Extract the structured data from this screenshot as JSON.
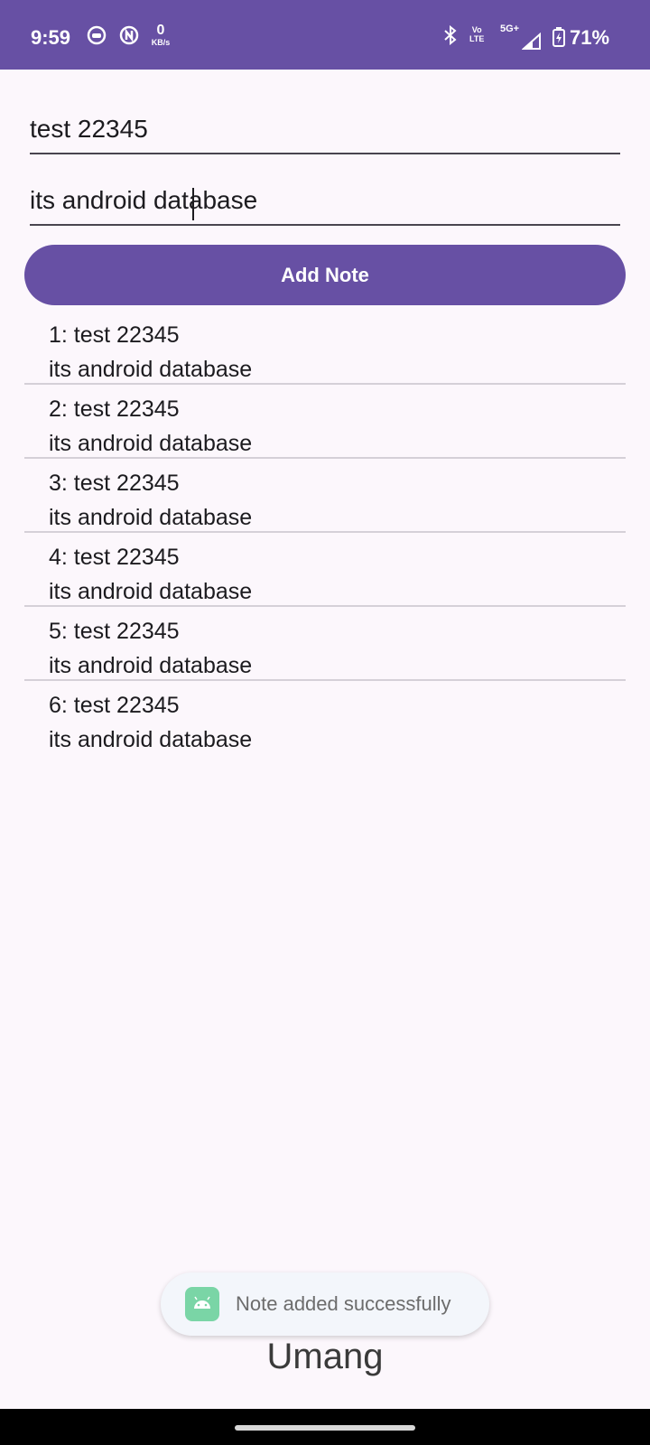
{
  "status_bar": {
    "time": "9:59",
    "net_speed_value": "0",
    "net_speed_unit": "KB/s",
    "volte_top": "Vo",
    "volte_bottom": "LTE",
    "network": "5G+",
    "battery_percent": "71%",
    "icons": [
      "app-notification-icon",
      "app-notification-icon-2",
      "bluetooth-icon",
      "signal-icon",
      "battery-charging-icon"
    ],
    "background_color": "#6750a4"
  },
  "form": {
    "title_value": "test 22345",
    "content_value": "its android database",
    "add_button_label": "Add Note"
  },
  "notes": [
    {
      "title": "1: test 22345",
      "body": "its android database"
    },
    {
      "title": "2: test 22345",
      "body": "its android database"
    },
    {
      "title": "3: test 22345",
      "body": "its android database"
    },
    {
      "title": "4: test 22345",
      "body": "its android database"
    },
    {
      "title": "5: test 22345",
      "body": "its android database"
    },
    {
      "title": "6: test 22345",
      "body": "its android database"
    }
  ],
  "toast": {
    "message": "Note added successfully",
    "icon": "android-app-icon"
  },
  "footer": {
    "name": "Umang"
  },
  "colors": {
    "primary": "#6750a4",
    "background": "#fcf7fc"
  }
}
